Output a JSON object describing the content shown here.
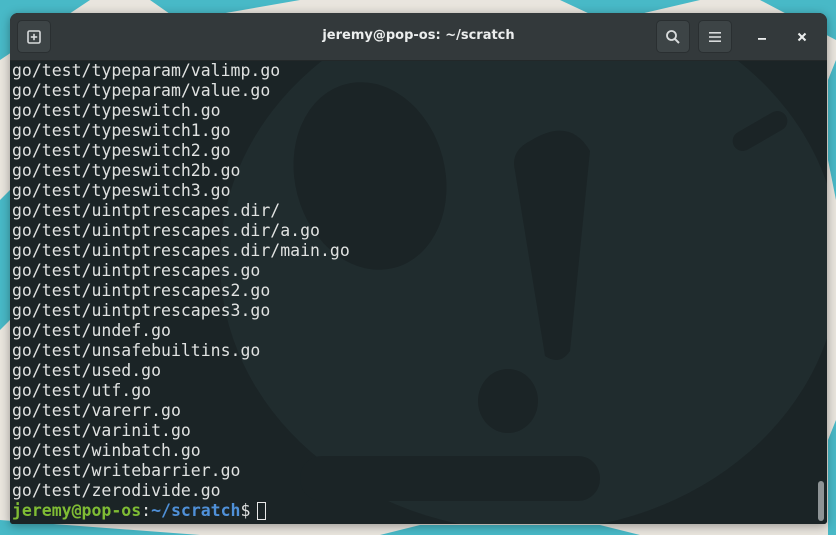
{
  "window": {
    "title": "jeremy@pop-os: ~/scratch"
  },
  "icons": {
    "new_tab": "new-tab-icon",
    "search": "search-icon",
    "menu": "hamburger-menu-icon",
    "minimize": "minimize-icon",
    "close": "close-icon",
    "watermark": "pop-os-logo-watermark"
  },
  "colors": {
    "titlebar": "#33393b",
    "terminal_bg": "#1b2426",
    "text": "#e0e2e1",
    "prompt_user": "#7fbc34",
    "prompt_path": "#4f90d8",
    "desktop_teal": "#48b9c7"
  },
  "terminal": {
    "lines": [
      "go/test/typeparam/valimp.go",
      "go/test/typeparam/value.go",
      "go/test/typeswitch.go",
      "go/test/typeswitch1.go",
      "go/test/typeswitch2.go",
      "go/test/typeswitch2b.go",
      "go/test/typeswitch3.go",
      "go/test/uintptrescapes.dir/",
      "go/test/uintptrescapes.dir/a.go",
      "go/test/uintptrescapes.dir/main.go",
      "go/test/uintptrescapes.go",
      "go/test/uintptrescapes2.go",
      "go/test/uintptrescapes3.go",
      "go/test/undef.go",
      "go/test/unsafebuiltins.go",
      "go/test/used.go",
      "go/test/utf.go",
      "go/test/varerr.go",
      "go/test/varinit.go",
      "go/test/winbatch.go",
      "go/test/writebarrier.go",
      "go/test/zerodivide.go"
    ],
    "prompt": {
      "user_host": "jeremy@pop-os",
      "colon": ":",
      "path": "~/scratch",
      "dollar": "$"
    }
  }
}
